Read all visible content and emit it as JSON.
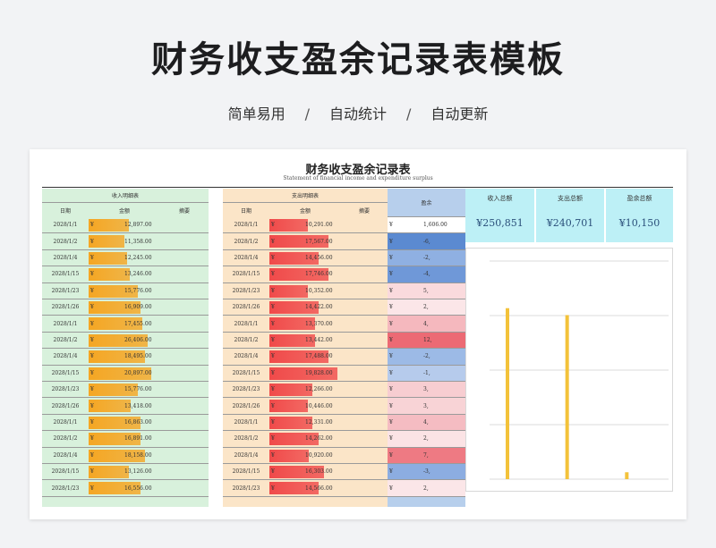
{
  "header": {
    "title": "财务收支盈余记录表模板",
    "tags": [
      "简单易用",
      "自动统计",
      "自动更新"
    ],
    "separator": "/"
  },
  "sheet": {
    "title": "财务收支盈余记录表",
    "subtitle": "Statement of financial income and expenditure surplus"
  },
  "income": {
    "section_title": "收入明细表",
    "columns": [
      "日期",
      "金额",
      "摘要"
    ],
    "currency": "¥",
    "rows": [
      {
        "date": "2028/1/1",
        "amount": "12,897.00",
        "level": 0.62
      },
      {
        "date": "2028/1/2",
        "amount": "11,358.00",
        "level": 0.55
      },
      {
        "date": "2028/1/4",
        "amount": "12,245.00",
        "level": 0.6
      },
      {
        "date": "2028/1/15",
        "amount": "13,246.00",
        "level": 0.64
      },
      {
        "date": "2028/1/23",
        "amount": "15,776.00",
        "level": 0.76
      },
      {
        "date": "2028/1/26",
        "amount": "16,909.00",
        "level": 0.81
      },
      {
        "date": "2028/1/1",
        "amount": "17,455.00",
        "level": 0.84
      },
      {
        "date": "2028/1/2",
        "amount": "26,406.00",
        "level": 0.92
      },
      {
        "date": "2028/1/4",
        "amount": "18,495.00",
        "level": 0.88
      },
      {
        "date": "2028/1/15",
        "amount": "20,897.00",
        "level": 0.97
      },
      {
        "date": "2028/1/23",
        "amount": "15,776.00",
        "level": 0.76
      },
      {
        "date": "2028/1/26",
        "amount": "13,418.00",
        "level": 0.65
      },
      {
        "date": "2028/1/1",
        "amount": "16,863.00",
        "level": 0.81
      },
      {
        "date": "2028/1/2",
        "amount": "16,891.00",
        "level": 0.81
      },
      {
        "date": "2028/1/4",
        "amount": "18,158.00",
        "level": 0.87
      },
      {
        "date": "2028/1/15",
        "amount": "13,126.00",
        "level": 0.63
      },
      {
        "date": "2028/1/23",
        "amount": "16,556.00",
        "level": 0.8
      }
    ]
  },
  "expense": {
    "section_title": "支出明细表",
    "columns": [
      "日期",
      "金额",
      "摘要"
    ],
    "currency": "¥",
    "rows": [
      {
        "date": "2028/1/1",
        "amount": "10,291.00",
        "level": 0.55
      },
      {
        "date": "2028/1/2",
        "amount": "17,567.00",
        "level": 0.84
      },
      {
        "date": "2028/1/4",
        "amount": "14,456.00",
        "level": 0.7
      },
      {
        "date": "2028/1/15",
        "amount": "17,746.00",
        "level": 0.85
      },
      {
        "date": "2028/1/23",
        "amount": "10,352.00",
        "level": 0.55
      },
      {
        "date": "2028/1/26",
        "amount": "14,422.00",
        "level": 0.7
      },
      {
        "date": "2028/1/1",
        "amount": "13,370.00",
        "level": 0.66
      },
      {
        "date": "2028/1/2",
        "amount": "13,442.00",
        "level": 0.66
      },
      {
        "date": "2028/1/4",
        "amount": "17,488.00",
        "level": 0.84
      },
      {
        "date": "2028/1/15",
        "amount": "19,828.00",
        "level": 0.98
      },
      {
        "date": "2028/1/23",
        "amount": "12,266.00",
        "level": 0.62
      },
      {
        "date": "2028/1/26",
        "amount": "10,446.00",
        "level": 0.55
      },
      {
        "date": "2028/1/1",
        "amount": "12,331.00",
        "level": 0.62
      },
      {
        "date": "2028/1/2",
        "amount": "14,262.00",
        "level": 0.7
      },
      {
        "date": "2028/1/4",
        "amount": "10,920.00",
        "level": 0.56
      },
      {
        "date": "2028/1/15",
        "amount": "16,303.00",
        "level": 0.78
      },
      {
        "date": "2028/1/23",
        "amount": "14,566.00",
        "level": 0.71
      }
    ]
  },
  "surplus": {
    "section_title": "盈余",
    "currency": "¥",
    "rows": [
      {
        "amount": "1,606.00",
        "color": "#ffffff"
      },
      {
        "amount": "-6,",
        "color": "#5b8ad1"
      },
      {
        "amount": "-2,",
        "color": "#8fb0e2"
      },
      {
        "amount": "-4,",
        "color": "#6f98d8"
      },
      {
        "amount": "5,",
        "color": "#fadadd"
      },
      {
        "amount": "2,",
        "color": "#fbe6e8"
      },
      {
        "amount": "4,",
        "color": "#f5b8be"
      },
      {
        "amount": "12,",
        "color": "#ec6a74"
      },
      {
        "amount": "-2,",
        "color": "#9cbae6"
      },
      {
        "amount": "-1,",
        "color": "#b6cbec"
      },
      {
        "amount": "3,",
        "color": "#f7cdd1"
      },
      {
        "amount": "3,",
        "color": "#f8d3d6"
      },
      {
        "amount": "4,",
        "color": "#f5bcc2"
      },
      {
        "amount": "2,",
        "color": "#fbe3e5"
      },
      {
        "amount": "7,",
        "color": "#ee7a83"
      },
      {
        "amount": "-3,",
        "color": "#8cade1"
      },
      {
        "amount": "2,",
        "color": "#fbe6e8"
      }
    ]
  },
  "summary": {
    "cards": [
      {
        "label": "收入总额",
        "value": "¥250,851"
      },
      {
        "label": "支出总额",
        "value": "¥240,701"
      },
      {
        "label": "盈余总额",
        "value": "¥10,150"
      }
    ]
  },
  "chart_data": {
    "type": "bar",
    "categories": [
      "",
      "",
      ""
    ],
    "series": [
      {
        "name": "",
        "values": [
          250851,
          240701,
          10150
        ],
        "color": "#f3c23a"
      }
    ],
    "title": "",
    "xlabel": "",
    "ylabel": "",
    "ylim": [
      0,
      320000
    ],
    "grid": true,
    "data_labels": [
      "",
      "",
      ""
    ]
  },
  "colors": {
    "income_bg": "#d8f1dc",
    "income_bar": "#f5a623",
    "expense_bg": "#fbe5c8",
    "expense_bar": "#f04a4a",
    "surplus_bg": "#b7cfec",
    "card_bg": "#bdf0f6"
  }
}
